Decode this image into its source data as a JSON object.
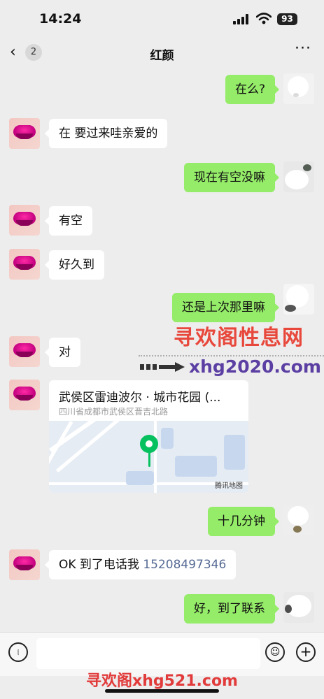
{
  "status_bar": {
    "time": "14:24",
    "battery": "93"
  },
  "nav": {
    "back_count": "2",
    "title": "红颜",
    "more": "···"
  },
  "messages": [
    {
      "side": "right",
      "text": "在么?"
    },
    {
      "side": "left",
      "text": "在 要过来哇亲爱的"
    },
    {
      "side": "right",
      "text": "现在有空没嘛"
    },
    {
      "side": "left",
      "text": "有空"
    },
    {
      "side": "left",
      "text": "好久到"
    },
    {
      "side": "right",
      "text": "还是上次那里嘛"
    },
    {
      "side": "left",
      "text": "对"
    },
    {
      "side": "left",
      "type": "location",
      "title": "武侯区雷迪波尔 · 城市花园 (...",
      "address": "四川省成都市武侯区晋吉北路",
      "map_provider": "腾讯地图"
    },
    {
      "side": "right",
      "text": "十几分钟"
    },
    {
      "side": "left",
      "text": "OK 到了电话我",
      "phone": "15208497346"
    },
    {
      "side": "right",
      "text": "好，到了联系"
    }
  ],
  "watermark": {
    "line1": "寻欢阁性息网",
    "line2": "xhg2020.com",
    "bottom": "寻欢阁xhg521.com"
  },
  "colors": {
    "bubble_self": "#95ec69",
    "bubble_other": "#ffffff",
    "background": "#ededed",
    "watermark_red": "#e8483c",
    "link": "#576b95"
  }
}
